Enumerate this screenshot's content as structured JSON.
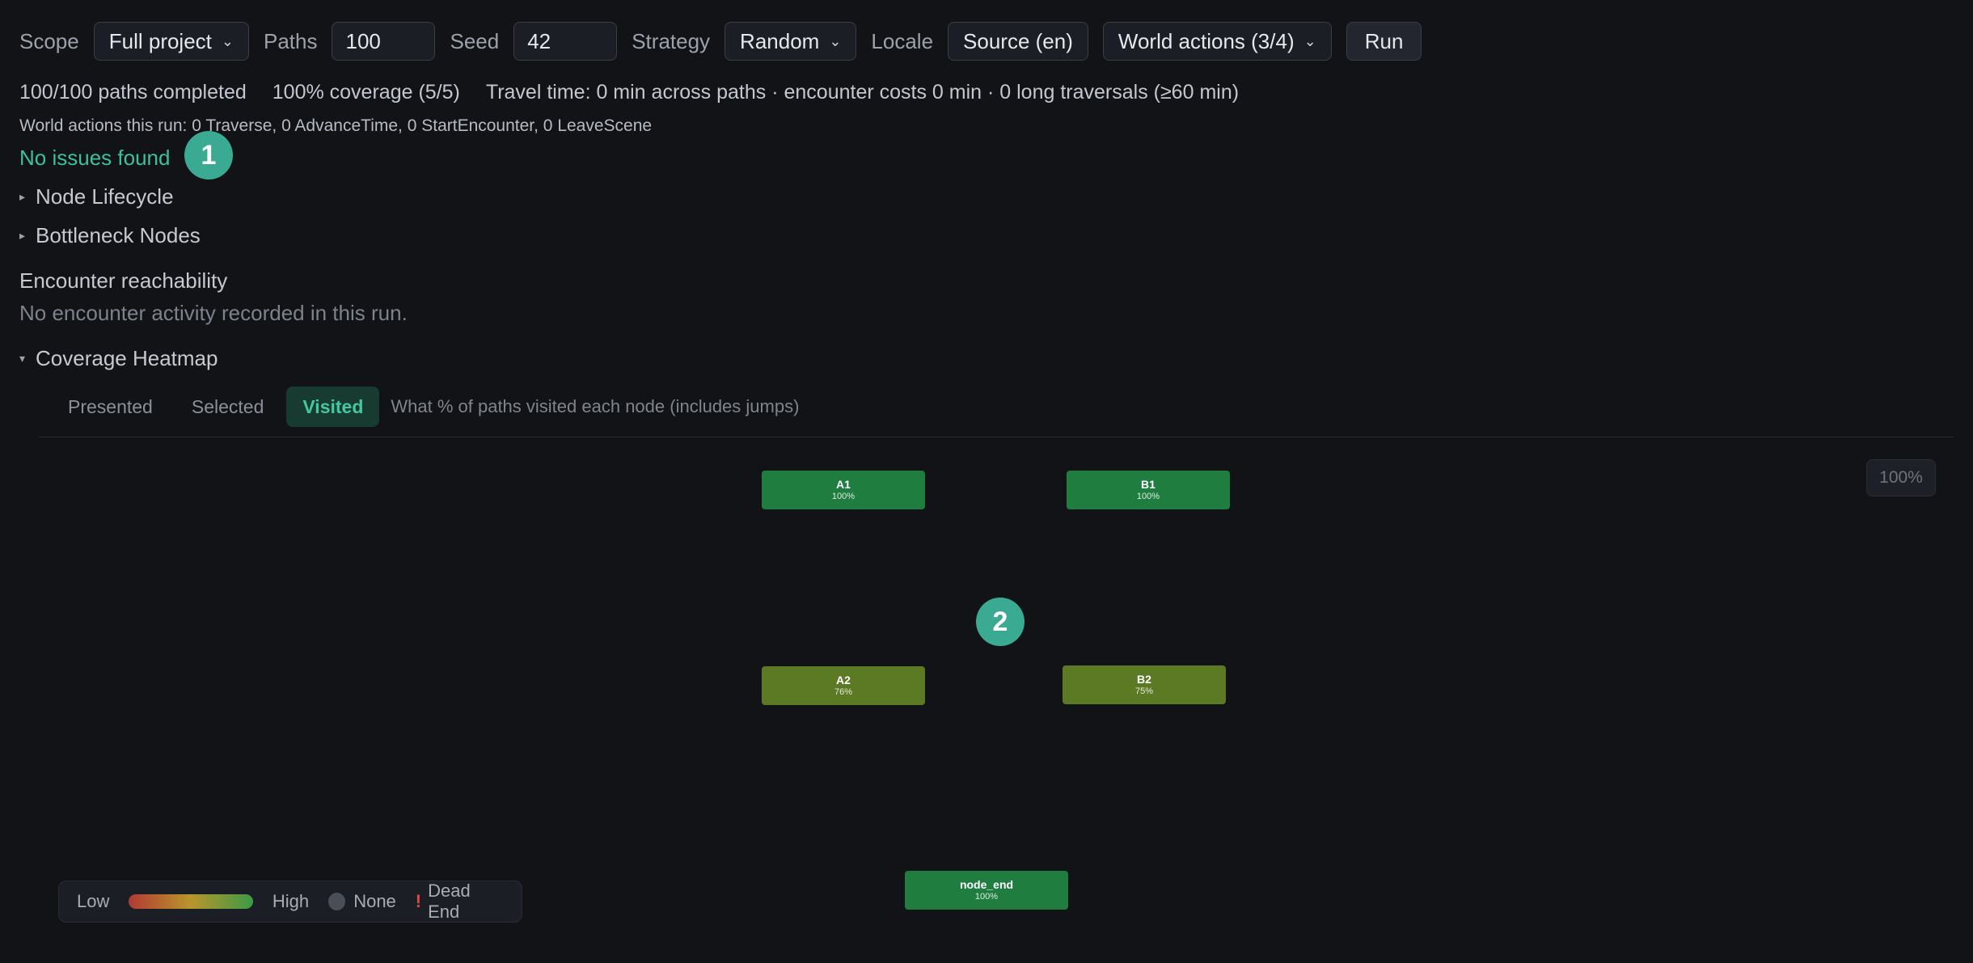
{
  "toolbar": {
    "scope_label": "Scope",
    "scope_value": "Full project",
    "paths_label": "Paths",
    "paths_value": "100",
    "seed_label": "Seed",
    "seed_value": "42",
    "strategy_label": "Strategy",
    "strategy_value": "Random",
    "locale_label": "Locale",
    "locale_value": "Source (en)",
    "world_actions_value": "World actions (3/4)",
    "run_label": "Run"
  },
  "summary": {
    "paths_completed": "100/100 paths completed",
    "coverage": "100% coverage (5/5)",
    "travel": "Travel time: 0 min across paths · encounter costs 0 min · 0 long traversals (≥60 min)"
  },
  "world_actions_line": "World actions this run: 0 Traverse, 0 AdvanceTime, 0 StartEncounter, 0 LeaveScene",
  "status": "No issues found",
  "badges": [
    "1",
    "2"
  ],
  "sections": {
    "node_lifecycle": "Node Lifecycle",
    "bottleneck_nodes": "Bottleneck Nodes",
    "encounter_title": "Encounter reachability",
    "encounter_text": "No encounter activity recorded in this run.",
    "coverage_heatmap": "Coverage Heatmap"
  },
  "heatmap": {
    "tabs": [
      "Presented",
      "Selected",
      "Visited"
    ],
    "active_tab": "Visited",
    "hint": "What % of paths visited each node (includes jumps)",
    "zoom": "100%",
    "nodes": [
      {
        "name": "A1",
        "pct": "100%",
        "value": 100
      },
      {
        "name": "B1",
        "pct": "100%",
        "value": 100
      },
      {
        "name": "A2",
        "pct": "76%",
        "value": 76
      },
      {
        "name": "B2",
        "pct": "75%",
        "value": 75
      },
      {
        "name": "node_end",
        "pct": "100%",
        "value": 100
      }
    ],
    "colors": {
      "high": "#1e7d3f",
      "mid": "#5c7a23"
    }
  },
  "legend": {
    "low": "Low",
    "high": "High",
    "none": "None",
    "dead_end_mark": "!",
    "dead_end": "Dead End"
  }
}
